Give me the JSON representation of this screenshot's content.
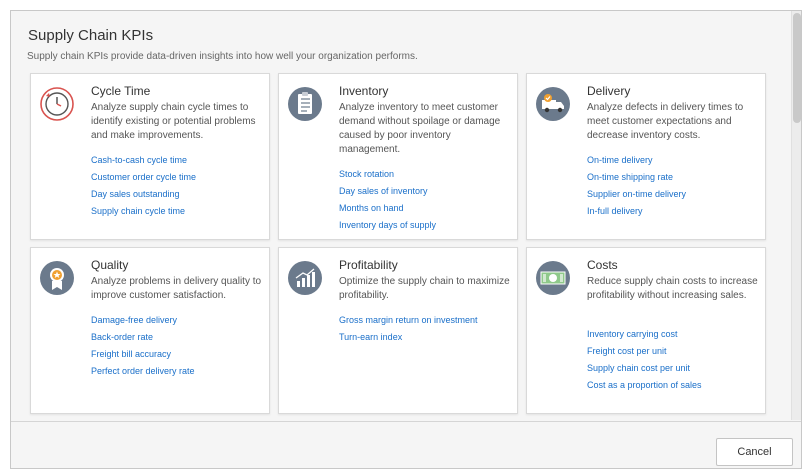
{
  "dialog": {
    "title": "Supply Chain KPIs",
    "subtitle": "Supply chain KPIs provide data-driven insights into how well your organization performs."
  },
  "cards": [
    {
      "title": "Cycle Time",
      "description": "Analyze supply chain cycle times to identify existing or potential problems and make improvements.",
      "icon": "clock-cycle-icon",
      "links": [
        "Cash-to-cash cycle time",
        "Customer order cycle time",
        "Day sales outstanding",
        "Supply chain cycle time"
      ]
    },
    {
      "title": "Inventory",
      "description": "Analyze inventory to meet customer demand without spoilage or damage caused by poor inventory management.",
      "icon": "checklist-icon",
      "links": [
        "Stock rotation",
        "Day sales of inventory",
        "Months on hand",
        "Inventory days of supply"
      ]
    },
    {
      "title": "Delivery",
      "description": "Analyze defects in delivery times to meet customer expectations and decrease inventory costs.",
      "icon": "delivery-truck-icon",
      "links": [
        "On-time delivery",
        "On-time shipping rate",
        "Supplier on-time delivery",
        "In-full delivery"
      ]
    },
    {
      "title": "Quality",
      "description": "Analyze problems in delivery quality to improve customer satisfaction.",
      "icon": "award-ribbon-icon",
      "links": [
        "Damage-free delivery",
        "Back-order rate",
        "Freight bill accuracy",
        "Perfect order delivery rate"
      ]
    },
    {
      "title": "Profitability",
      "description": "Optimize the supply chain to maximize profitability.",
      "icon": "growth-chart-icon",
      "links": [
        "Gross margin return on investment",
        "Turn-earn index"
      ]
    },
    {
      "title": "Costs",
      "description": "Reduce supply chain costs to increase profitability without increasing sales.",
      "icon": "money-bill-icon",
      "links": [
        "Inventory carrying cost",
        "Freight cost per unit",
        "Supply chain cost per unit",
        "Cost as a proportion of sales"
      ]
    }
  ],
  "footer": {
    "cancel_label": "Cancel"
  },
  "colors": {
    "link": "#1a6fc9",
    "icon_circle": "#6b7a8c",
    "accent_red": "#d9534f",
    "accent_orange": "#f0a030"
  }
}
